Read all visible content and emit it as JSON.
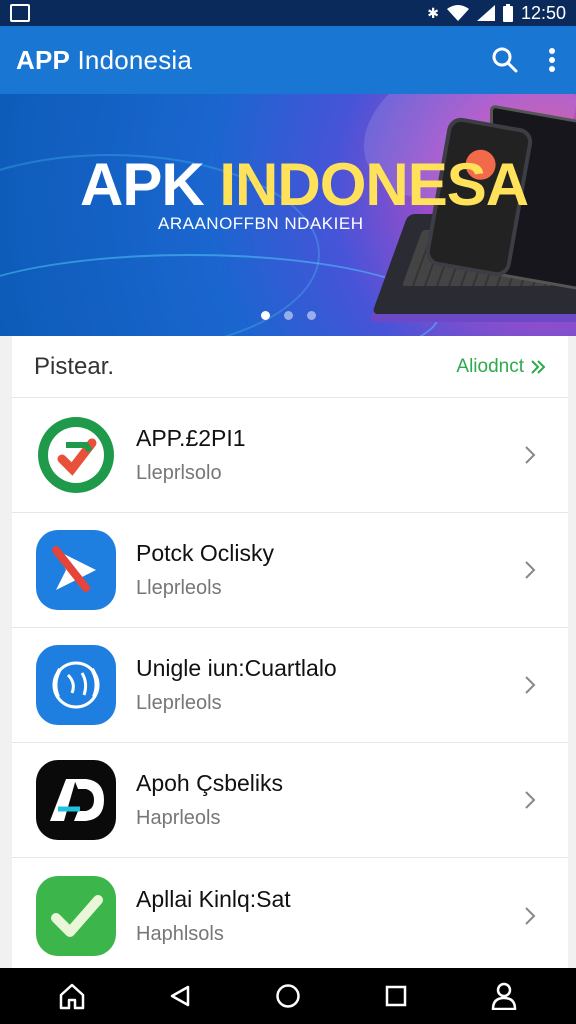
{
  "status_bar": {
    "time": "12:50"
  },
  "app_bar": {
    "title_bold": "APP",
    "title_light": " Indonesia"
  },
  "banner": {
    "headline_white": "APK",
    "headline_yellow": " INDONESA",
    "subtitle": "ARAANOFFBN NDAKIEH",
    "page_count": 3,
    "active_page": 1
  },
  "section": {
    "title": "Pistear.",
    "link_label": "Aliodnct"
  },
  "apps": [
    {
      "name": "APP.£2PI1",
      "subtitle": "Lleprlsolo",
      "icon": "shield-check-icon"
    },
    {
      "name": "Potck Oclisky",
      "subtitle": "Lleprleols",
      "icon": "send-arrow-icon"
    },
    {
      "name": "Unigle iun:Cuartlalo",
      "subtitle": "Lleprleols",
      "icon": "globe-laurel-icon"
    },
    {
      "name": "Apoh Çsbeliks",
      "subtitle": "Haprleols",
      "icon": "ad-logo-icon"
    },
    {
      "name": "Apllai Kinlq:Sat",
      "subtitle": "Haphlsols",
      "icon": "checkmark-icon"
    }
  ],
  "colors": {
    "status_bar": "#0b2a5c",
    "app_bar": "#1976d2",
    "accent_green": "#2ea94d",
    "nav_bar": "#000000"
  }
}
